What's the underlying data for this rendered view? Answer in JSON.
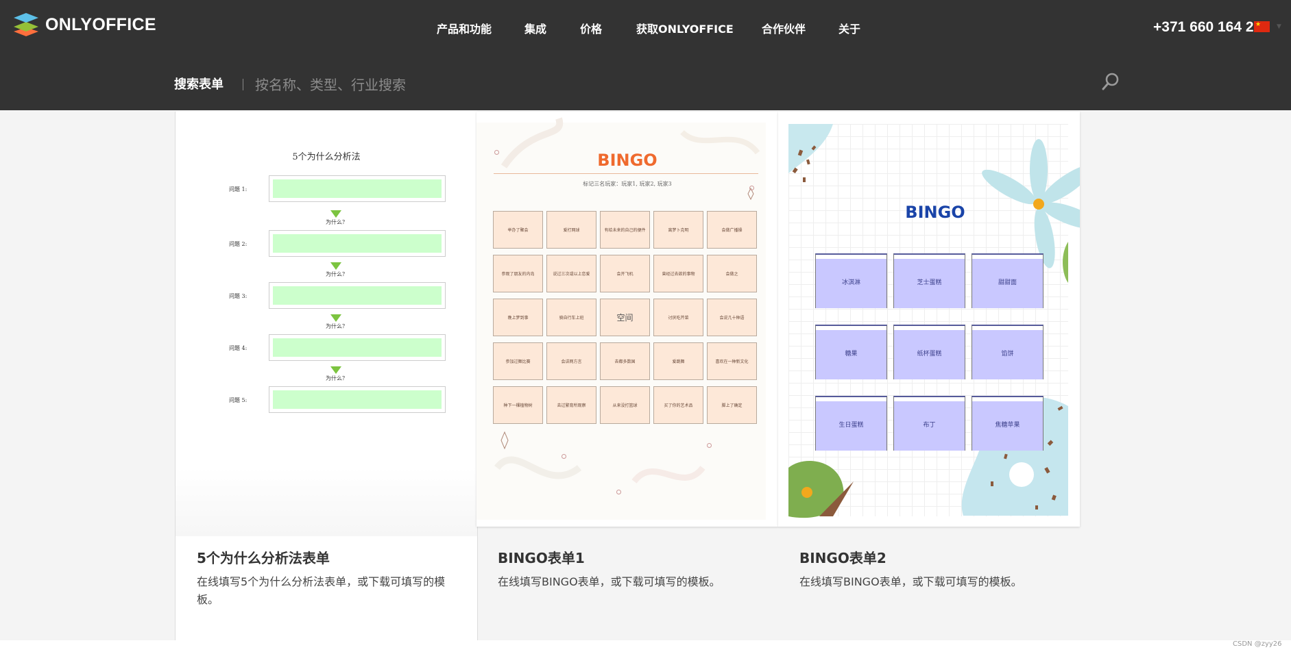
{
  "brand": {
    "name": "ONLYOFFICE"
  },
  "nav": {
    "items": [
      "产品和功能",
      "集成",
      "价格",
      "获取ONLYOFFICE",
      "合作伙伴",
      "关于"
    ]
  },
  "header": {
    "phone": "+371 660 164 25"
  },
  "search": {
    "label": "搜索表单",
    "placeholder": "按名称、类型、行业搜索"
  },
  "cards": [
    {
      "title": "5个为什么分析法表单",
      "description": "在线填写5个为什么分析法表单，或下载可填写的模板。",
      "preview": {
        "heading": "5个为什么分析法",
        "questions": [
          "问题 1:",
          "问题 2:",
          "问题 3:",
          "问题 4:",
          "问题 5:"
        ],
        "why_label": "为什么？"
      }
    },
    {
      "title": "BINGO表单1",
      "description": "在线填写BINGO表单，或下载可填写的模板。",
      "preview": {
        "heading": "BINGO",
        "subheading": "标记三名玩家：玩家1, 玩家2, 玩家3",
        "cells": [
          "举办了聚会",
          "爱打网球",
          "有给未来的自己的便件",
          "离梦卜克明",
          "会做广播操",
          "参观了朋友的内岛",
          "说过三次或以上恋爱",
          "会开飞机",
          "曾经过去欲的事物",
          "会做之",
          "晚上梦到事",
          "骑自行车上班",
          "空间",
          "讨厌吃芹菜",
          "会说几十种语",
          "参加过舞比赛",
          "会讲两方言",
          "去都多数国",
          "爱跳舞",
          "喜欢在一种新文化",
          "种下一棵植物树",
          "去过繁育所观察",
          "从来没打篮球",
          "买了你的艺术品",
          "脚上了确定"
        ]
      }
    },
    {
      "title": "BINGO表单2",
      "description": "在线填写BINGO表单，或下载可填写的模板。",
      "preview": {
        "heading": "BINGO",
        "cells": [
          "冰淇淋",
          "芝士蛋糕",
          "甜甜面",
          "糖果",
          "纸杯蛋糕",
          "馅饼",
          "生日蛋糕",
          "布丁",
          "焦糖苹果"
        ]
      }
    }
  ],
  "footer": {
    "watermark": "CSDN @zyy26"
  },
  "colors": {
    "header_bg": "#333333",
    "bingo1_title": "#ef6a2e",
    "bingo2_title": "#1a44a8",
    "green_fill": "#ccffcc",
    "arrow_green": "#7cc440",
    "bingo1_cell": "#fde8d8",
    "bingo2_cell": "#c9c8ff"
  },
  "icons": [
    "onlyoffice-logo-icon",
    "search-icon",
    "china-flag-icon",
    "chevron-down-icon",
    "arrow-down-icon"
  ]
}
